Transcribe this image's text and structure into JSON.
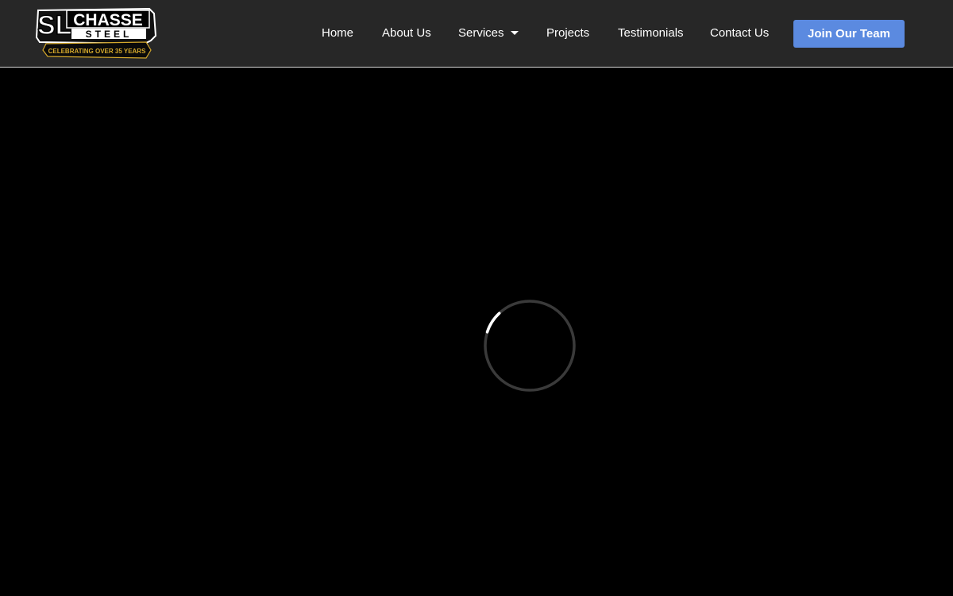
{
  "logo": {
    "line1": "SL CHASSE",
    "line2": "STEEL",
    "tagline": "CELEBRATING OVER 35 YEARS"
  },
  "nav": {
    "items": [
      {
        "label": "Home"
      },
      {
        "label": "About Us"
      },
      {
        "label": "Services"
      },
      {
        "label": "Projects"
      },
      {
        "label": "Testimonials"
      },
      {
        "label": "Contact Us"
      }
    ],
    "cta": "Join Our Team"
  },
  "colors": {
    "header_bg": "#272727",
    "cta_bg": "#5b8ae0",
    "page_bg": "#000000",
    "logo_gold": "#d4a82c"
  },
  "icons": {
    "services_dropdown": "caret-down-icon",
    "loader": "loading-spinner-icon"
  }
}
